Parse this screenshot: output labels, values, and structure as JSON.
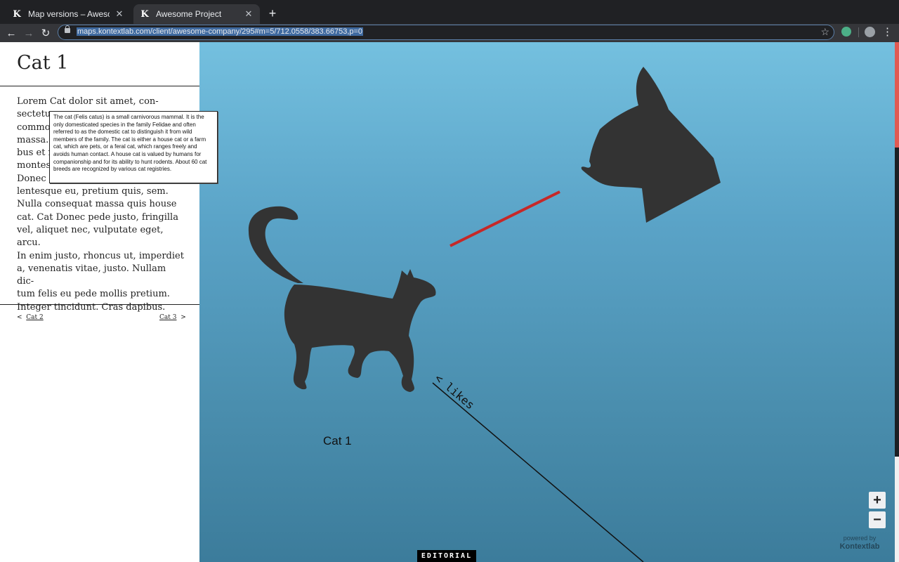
{
  "browser": {
    "tabs": [
      {
        "favicon": "K",
        "title": "Map versions – Awesome Proje"
      },
      {
        "favicon": "K",
        "title": "Awesome Project"
      }
    ],
    "new_tab": "+",
    "url": "maps.kontextlab.com/client/awesome-company/295#m=5/712.0558/383.66753,p=0"
  },
  "sidebar": {
    "title": "Cat 1",
    "body": "Lorem Cat dolor sit amet, con-\nsectetu\ncommo\nmassa.\nbus et m\nmontes\nDonec q\nlentesque eu, pretium quis, sem.\nNulla consequat massa quis house\ncat. Cat Donec pede justo, fringilla\nvel, aliquet nec, vulputate eget, arcu.\nIn enim justo, rhoncus ut, imperdiet\na, venenatis vitae, justo. Nullam dic-\ntum felis eu pede mollis pretium.\nInteger tincidunt. Cras dapibus.",
    "prev_arrow": "<",
    "prev_label": "Cat 2",
    "next_label": "Cat 3",
    "next_arrow": ">"
  },
  "tooltip": {
    "text": "The cat (Felis catus) is a small carnivorous mammal. It is the only domesticated species in the family Felidae and often referred to as the domestic cat to distinguish it from wild members of the family. The cat is either a house cat or a farm cat, which are pets, or a feral cat, which ranges freely and avoids human contact. A house cat is valued by humans for companionship and for its ability to hunt rodents. About 60 cat breeds are recognized by various cat registries."
  },
  "map": {
    "cat_label": "Cat 1",
    "connection_label": "< likes",
    "zoom_in": "+",
    "zoom_out": "−",
    "powered_by": "powered by",
    "brand": "Kontextlab",
    "editorial": "EDITORIAL",
    "colors": {
      "silhouette": "#333333",
      "red_line": "#c62828",
      "accent": "#e05a52"
    }
  }
}
